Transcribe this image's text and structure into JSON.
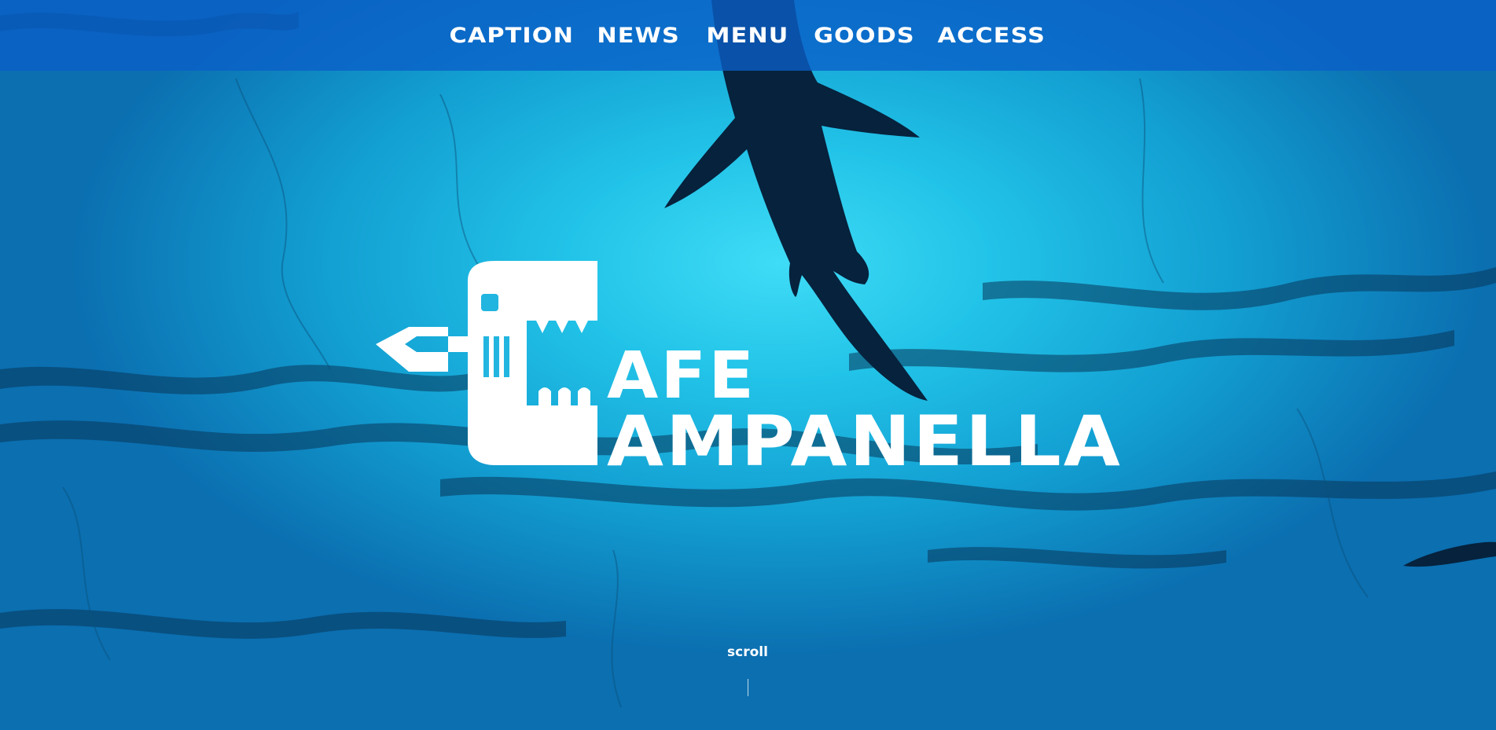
{
  "nav": {
    "items": [
      {
        "label": "CAPTION"
      },
      {
        "label": "NEWS"
      },
      {
        "label": "MENU"
      },
      {
        "label": "GOODS"
      },
      {
        "label": "ACCESS"
      }
    ]
  },
  "hero": {
    "logo": {
      "line1": "AFE",
      "line2": "AMPANELLA"
    },
    "scroll_label": "scroll"
  },
  "colors": {
    "nav_background": "#0a5fc8",
    "water_light": "#3fdcf6",
    "water_dark": "#0b6fb0",
    "text": "#ffffff"
  }
}
